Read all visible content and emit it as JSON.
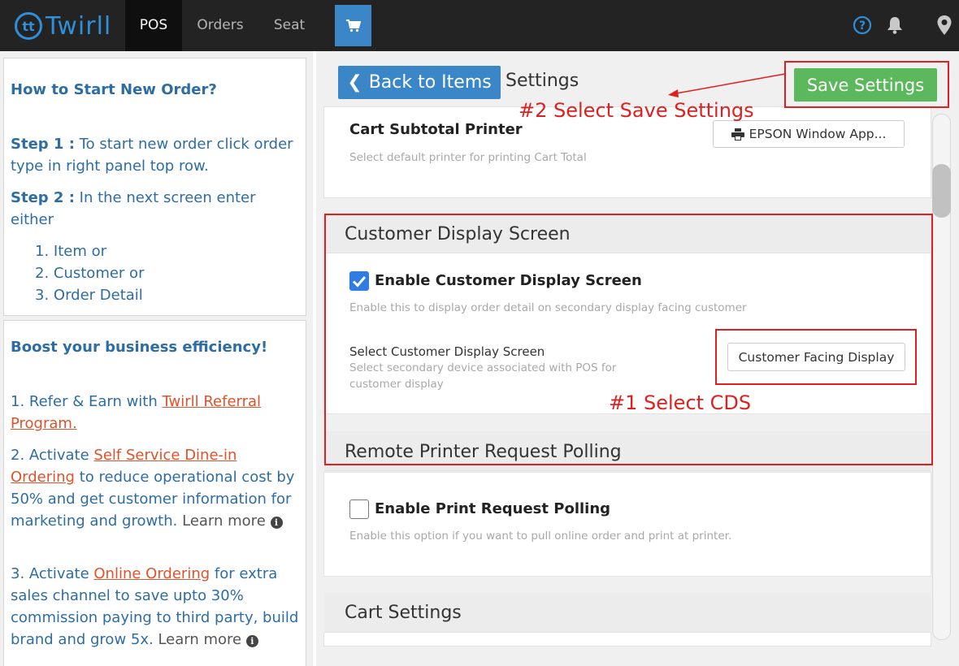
{
  "app": {
    "logo_text": "Twirll",
    "logo_mark": "tt"
  },
  "nav": {
    "pos": "POS",
    "orders": "Orders",
    "seat": "Seat"
  },
  "help_panel": {
    "title": "How to Start New Order?",
    "step1_label": "Step 1 :",
    "step1_text": "To start new order click order type in right panel top row.",
    "step2_label": "Step 2 :",
    "step2_text": "In the next screen enter either",
    "options": [
      "1. Item or",
      "2. Customer or",
      "3. Order Detail"
    ]
  },
  "boost_panel": {
    "title": "Boost your business efficiency!",
    "item1_prefix": "1. Refer & Earn with ",
    "item1_link": "Twirll Referral Program.",
    "item2_prefix": "2. Activate ",
    "item2_link": "Self Service Dine-in Ordering",
    "item2_suffix": " to reduce operational cost by 50% and get customer information for marketing and growth.",
    "item3_prefix": "3. Activate ",
    "item3_link": "Online Ordering",
    "item3_suffix": " for extra sales channel to save upto 30% commission paying to third party, build brand and grow 5x.",
    "learn_more": "Learn more"
  },
  "settings": {
    "back_label": "Back to Items",
    "title": "Settings",
    "save_label": "Save Settings",
    "cart_subtotal_printer": {
      "label": "Cart Subtotal Printer",
      "desc": "Select default printer for printing Cart Total",
      "value": "EPSON Window App..."
    },
    "cds": {
      "header": "Customer Display Screen",
      "enable_label": "Enable Customer Display Screen",
      "enable_checked": true,
      "enable_desc": "Enable this to display order detail on secondary display facing customer",
      "select_label": "Select Customer Display Screen",
      "select_desc_1": "Select secondary device associated with POS for",
      "select_desc_2": "customer display",
      "select_value": "Customer Facing Display"
    },
    "polling": {
      "header": "Remote Printer Request Polling",
      "enable_label": "Enable Print Request Polling",
      "enable_checked": false,
      "enable_desc": "Enable this option if you want to pull online order and print at printer."
    },
    "cart_settings": {
      "header": "Cart Settings"
    }
  },
  "annotations": {
    "step1": "#1 Select CDS",
    "step2": "#2 Select Save Settings"
  },
  "colors": {
    "accent": "#3b86c6",
    "save": "#5cb85c",
    "annotation": "#e02020",
    "link": "#e0522c"
  }
}
